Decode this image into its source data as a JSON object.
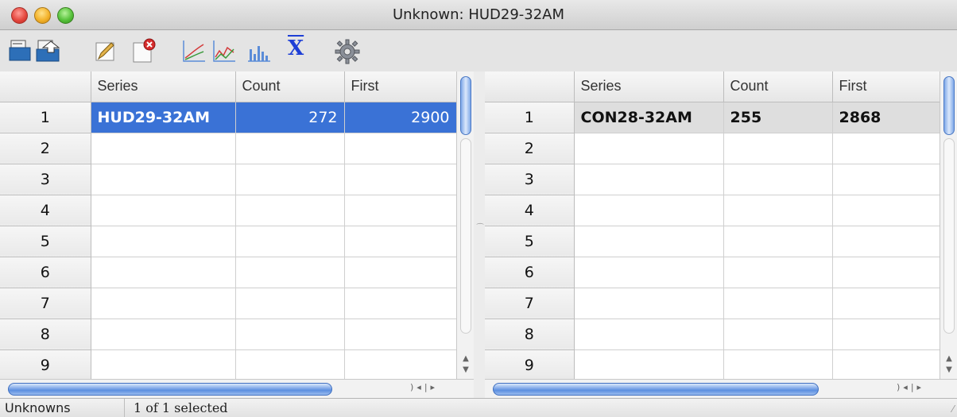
{
  "window": {
    "title": "Unknown: HUD29-32AM"
  },
  "toolbar": {
    "icons": [
      "open-file-icon",
      "save-file-icon",
      "edit-icon",
      "remove-icon",
      "line-chart-icon",
      "multi-line-chart-icon",
      "bar-chart-icon",
      "mean-icon",
      "settings-icon"
    ],
    "mean_symbol": "X"
  },
  "left_table": {
    "headers": [
      "Series",
      "Count",
      "First"
    ],
    "rows": [
      {
        "num": "1",
        "series": "HUD29-32AM",
        "count": "272",
        "first": "2900"
      },
      {
        "num": "2",
        "series": "",
        "count": "",
        "first": ""
      },
      {
        "num": "3",
        "series": "",
        "count": "",
        "first": ""
      },
      {
        "num": "4",
        "series": "",
        "count": "",
        "first": ""
      },
      {
        "num": "5",
        "series": "",
        "count": "",
        "first": ""
      },
      {
        "num": "6",
        "series": "",
        "count": "",
        "first": ""
      },
      {
        "num": "7",
        "series": "",
        "count": "",
        "first": ""
      },
      {
        "num": "8",
        "series": "",
        "count": "",
        "first": ""
      },
      {
        "num": "9",
        "series": "",
        "count": "",
        "first": ""
      }
    ]
  },
  "right_table": {
    "headers": [
      "Series",
      "Count",
      "First"
    ],
    "rows": [
      {
        "num": "1",
        "series": "CON28-32AM",
        "count": "255",
        "first": "2868"
      },
      {
        "num": "2",
        "series": "",
        "count": "",
        "first": ""
      },
      {
        "num": "3",
        "series": "",
        "count": "",
        "first": ""
      },
      {
        "num": "4",
        "series": "",
        "count": "",
        "first": ""
      },
      {
        "num": "5",
        "series": "",
        "count": "",
        "first": ""
      },
      {
        "num": "6",
        "series": "",
        "count": "",
        "first": ""
      },
      {
        "num": "7",
        "series": "",
        "count": "",
        "first": ""
      },
      {
        "num": "8",
        "series": "",
        "count": "",
        "first": ""
      },
      {
        "num": "9",
        "series": "",
        "count": "",
        "first": ""
      }
    ]
  },
  "status": {
    "left": "Unknowns",
    "right": "1 of 1 selected"
  },
  "colors": {
    "selection": "#3a72d6",
    "accent": "#5c8fe0"
  }
}
